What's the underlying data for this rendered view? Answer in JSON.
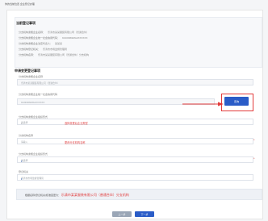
{
  "breadcrumb": "你的当前位置 企业登记办理",
  "info": {
    "title": "当前登记事项",
    "rows": [
      {
        "label": "分支机构隶属企业名称：",
        "value": "乐清市某某服装有限公司（普通合伙）"
      },
      {
        "label": "分支机构隶属企业统一社会信用代码：",
        "value": "91330382MA2XXXXXX"
      },
      {
        "label": "分支机构隶属企业法定代表人：",
        "value": "某某某"
      },
      {
        "label": "分支机构登记机关：",
        "value": "乐清市市场监督管理局"
      },
      {
        "label": "分支机构名称：",
        "value": "乐清市某某服装有限公司（普通合伙）分支机构"
      }
    ]
  },
  "section_title": "申请变更登记事项",
  "fields": [
    {
      "label": "分支机构隶属企业名称",
      "value": "乐清市某某服装有限公司（普通合伙）"
    },
    {
      "label": "分支机构隶属企业统一社会信用代码",
      "value": "91330382MA2XXXXXX"
    },
    {
      "label": "分支机构隶属企业组织形式",
      "value": "请选择"
    },
    {
      "label": "分支机构名称",
      "value": "请输入"
    },
    {
      "label": "分支机构隶属企业组织形式",
      "value": "请选择"
    },
    {
      "label": "登记机关",
      "value": "乐清市市场监督管理局"
    }
  ],
  "query_button": "查询",
  "annotations": {
    "select_type": "选择变更后企业类型",
    "change_name": "更改分支机构名称"
  },
  "notice": {
    "prefix": "根据名称(登记机关)核准变更为：",
    "highlight": "乐清市某某服装有限公司（普通合伙）分支机构"
  },
  "buttons": {
    "prev": "上一步",
    "next": "下一步"
  },
  "colors": {
    "primary": "#2a5cc7",
    "alert": "#e23b3b"
  }
}
